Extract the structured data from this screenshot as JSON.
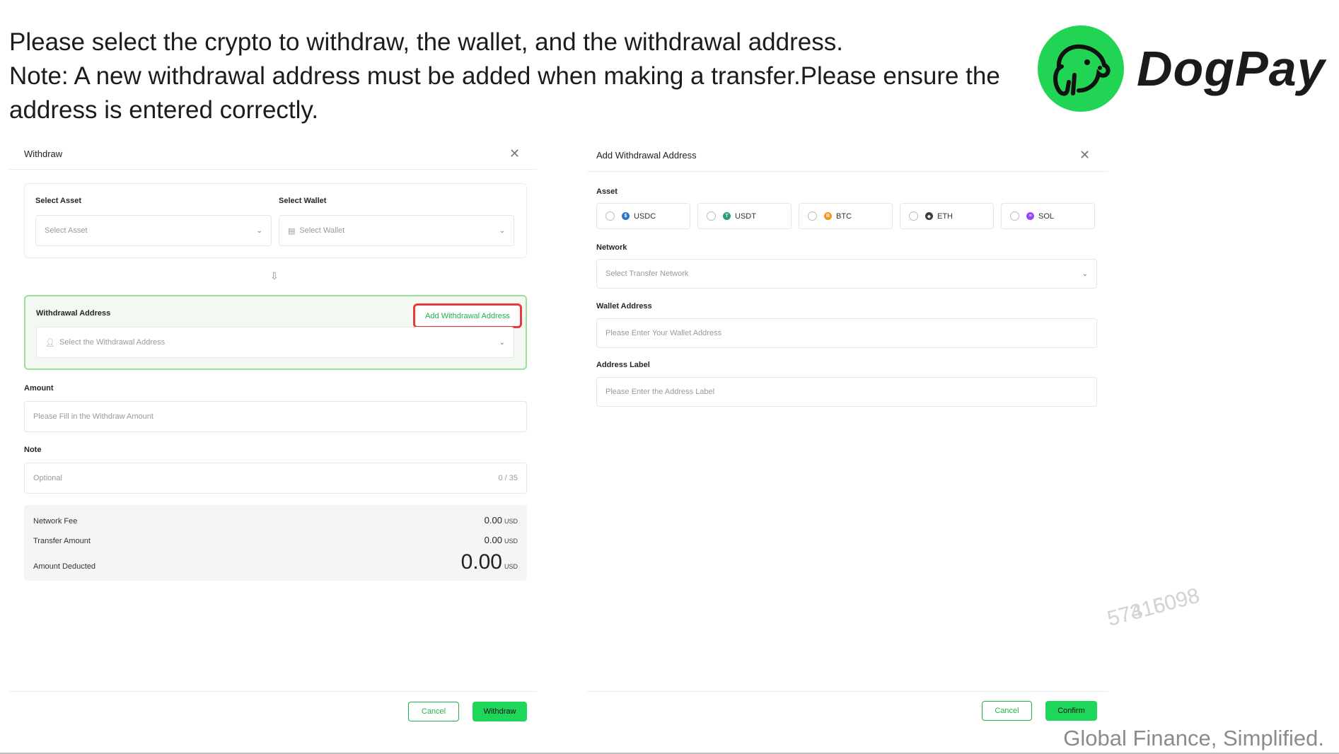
{
  "instructions": {
    "line1": "Please select the crypto to withdraw, the wallet, and the withdrawal address.",
    "line2": "Note: A new withdrawal address must be added when making a transfer.Please ensure the",
    "line3": "address is entered correctly."
  },
  "brand": {
    "name": "DogPay",
    "logo_icon": "dog-face-icon",
    "color": "#22d454"
  },
  "tagline": "Global Finance, Simplified.",
  "watermark": {
    "a": "57315098",
    "b": "57416098"
  },
  "withdraw_dialog": {
    "title": "Withdraw",
    "close_icon": "close-icon",
    "select_asset": {
      "label": "Select Asset",
      "placeholder": "Select Asset"
    },
    "select_wallet": {
      "label": "Select Wallet",
      "placeholder": "Select Wallet",
      "icon": "wallet-icon"
    },
    "withdrawal_address": {
      "label": "Withdrawal Address",
      "add_button": "Add Withdrawal Address",
      "placeholder": "Select the Withdrawal Address",
      "icon": "user-icon"
    },
    "amount": {
      "label": "Amount",
      "placeholder": "Please Fill in the Withdraw Amount"
    },
    "note": {
      "label": "Note",
      "placeholder": "Optional",
      "counter": "0 / 35"
    },
    "summary": {
      "network_fee": {
        "label": "Network Fee",
        "value": "0.00",
        "unit": "USD"
      },
      "transfer_amount": {
        "label": "Transfer Amount",
        "value": "0.00",
        "unit": "USD"
      },
      "amount_deducted": {
        "label": "Amount Deducted",
        "value": "0.00",
        "unit": "USD"
      }
    },
    "cancel": "Cancel",
    "submit": "Withdraw"
  },
  "add_address_dialog": {
    "title": "Add Withdrawal Address",
    "close_icon": "close-icon",
    "asset_label": "Asset",
    "assets": [
      {
        "name": "USDC",
        "color": "#2775ca"
      },
      {
        "name": "USDT",
        "color": "#26a17b"
      },
      {
        "name": "BTC",
        "color": "#f7931a"
      },
      {
        "name": "ETH",
        "color": "#3c3c3d"
      },
      {
        "name": "SOL",
        "color": "#9945ff"
      }
    ],
    "network": {
      "label": "Network",
      "placeholder": "Select Transfer Network"
    },
    "wallet_address": {
      "label": "Wallet Address",
      "placeholder": "Please Enter Your Wallet Address"
    },
    "address_label": {
      "label": "Address Label",
      "placeholder": "Please Enter the Address Label"
    },
    "cancel": "Cancel",
    "confirm": "Confirm"
  },
  "colors": {
    "accent": "#1ed65a",
    "highlight": "#e53b3b"
  }
}
